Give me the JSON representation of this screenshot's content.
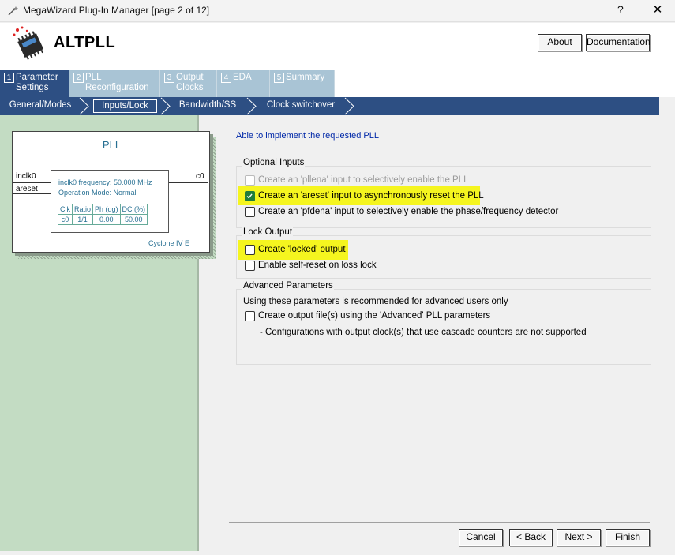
{
  "window": {
    "title": "MegaWizard Plug-In Manager [page 2 of 12]",
    "help_label": "?",
    "close_label": "✕"
  },
  "header": {
    "app_name": "ALTPLL",
    "about_label": "About",
    "documentation_label": "Documentation"
  },
  "tabs": [
    {
      "num": "1",
      "line1": "Parameter",
      "line2": "Settings",
      "active": true
    },
    {
      "num": "2",
      "line1": "PLL",
      "line2": "Reconfiguration",
      "active": false
    },
    {
      "num": "3",
      "line1": "Output",
      "line2": "Clocks",
      "active": false
    },
    {
      "num": "4",
      "line1": "EDA",
      "line2": "",
      "active": false
    },
    {
      "num": "5",
      "line1": "Summary",
      "line2": "",
      "active": false
    }
  ],
  "subtabs": [
    {
      "label": "General/Modes",
      "active": false
    },
    {
      "label": "Inputs/Lock",
      "active": true
    },
    {
      "label": "Bandwidth/SS",
      "active": false
    },
    {
      "label": "Clock switchover",
      "active": false
    }
  ],
  "pll_diagram": {
    "title": "PLL",
    "input1": "inclk0",
    "input2": "areset",
    "output": "c0",
    "frequency": "inclk0 frequency: 50.000 MHz",
    "mode": "Operation Mode: Normal",
    "table": {
      "headers": [
        "Clk",
        "Ratio",
        "Ph (dg)",
        "DC (%)"
      ],
      "rows": [
        [
          "c0",
          "1/1",
          "0.00",
          "50.00"
        ]
      ]
    },
    "family": "Cyclone IV E"
  },
  "status_message": "Able to implement the requested PLL",
  "optional_inputs": {
    "title": "Optional Inputs",
    "options": [
      {
        "label": "Create an 'pllena' input to selectively enable the PLL",
        "checked": false,
        "disabled": true
      },
      {
        "label": "Create an 'areset' input to asynchronously reset the PLL",
        "checked": true,
        "disabled": false
      },
      {
        "label": "Create an 'pfdena' input to selectively enable the phase/frequency detector",
        "checked": false,
        "disabled": false
      }
    ]
  },
  "lock_output": {
    "title": "Lock Output",
    "options": [
      {
        "label": "Create 'locked' output",
        "checked": false,
        "disabled": false
      },
      {
        "label": "Enable self-reset on loss lock",
        "checked": false,
        "disabled": false
      }
    ]
  },
  "advanced": {
    "title": "Advanced Parameters",
    "description": "Using these parameters is recommended for advanced users only",
    "option_label": "Create output file(s) using the 'Advanced' PLL parameters",
    "option_checked": false,
    "note": "- Configurations with output clock(s) that use cascade counters are not supported"
  },
  "footer": {
    "cancel_label": "Cancel",
    "back_label": "< Back",
    "next_label": "Next >",
    "finish_label": "Finish"
  },
  "colors": {
    "tab_active": "#2d4f83",
    "tab_inactive": "#a9c4d5",
    "left_panel": "#c3dcc3",
    "highlight": "#f5f51f",
    "checkbox_checked": "#1f7d3b",
    "status_text": "#0028a8"
  }
}
